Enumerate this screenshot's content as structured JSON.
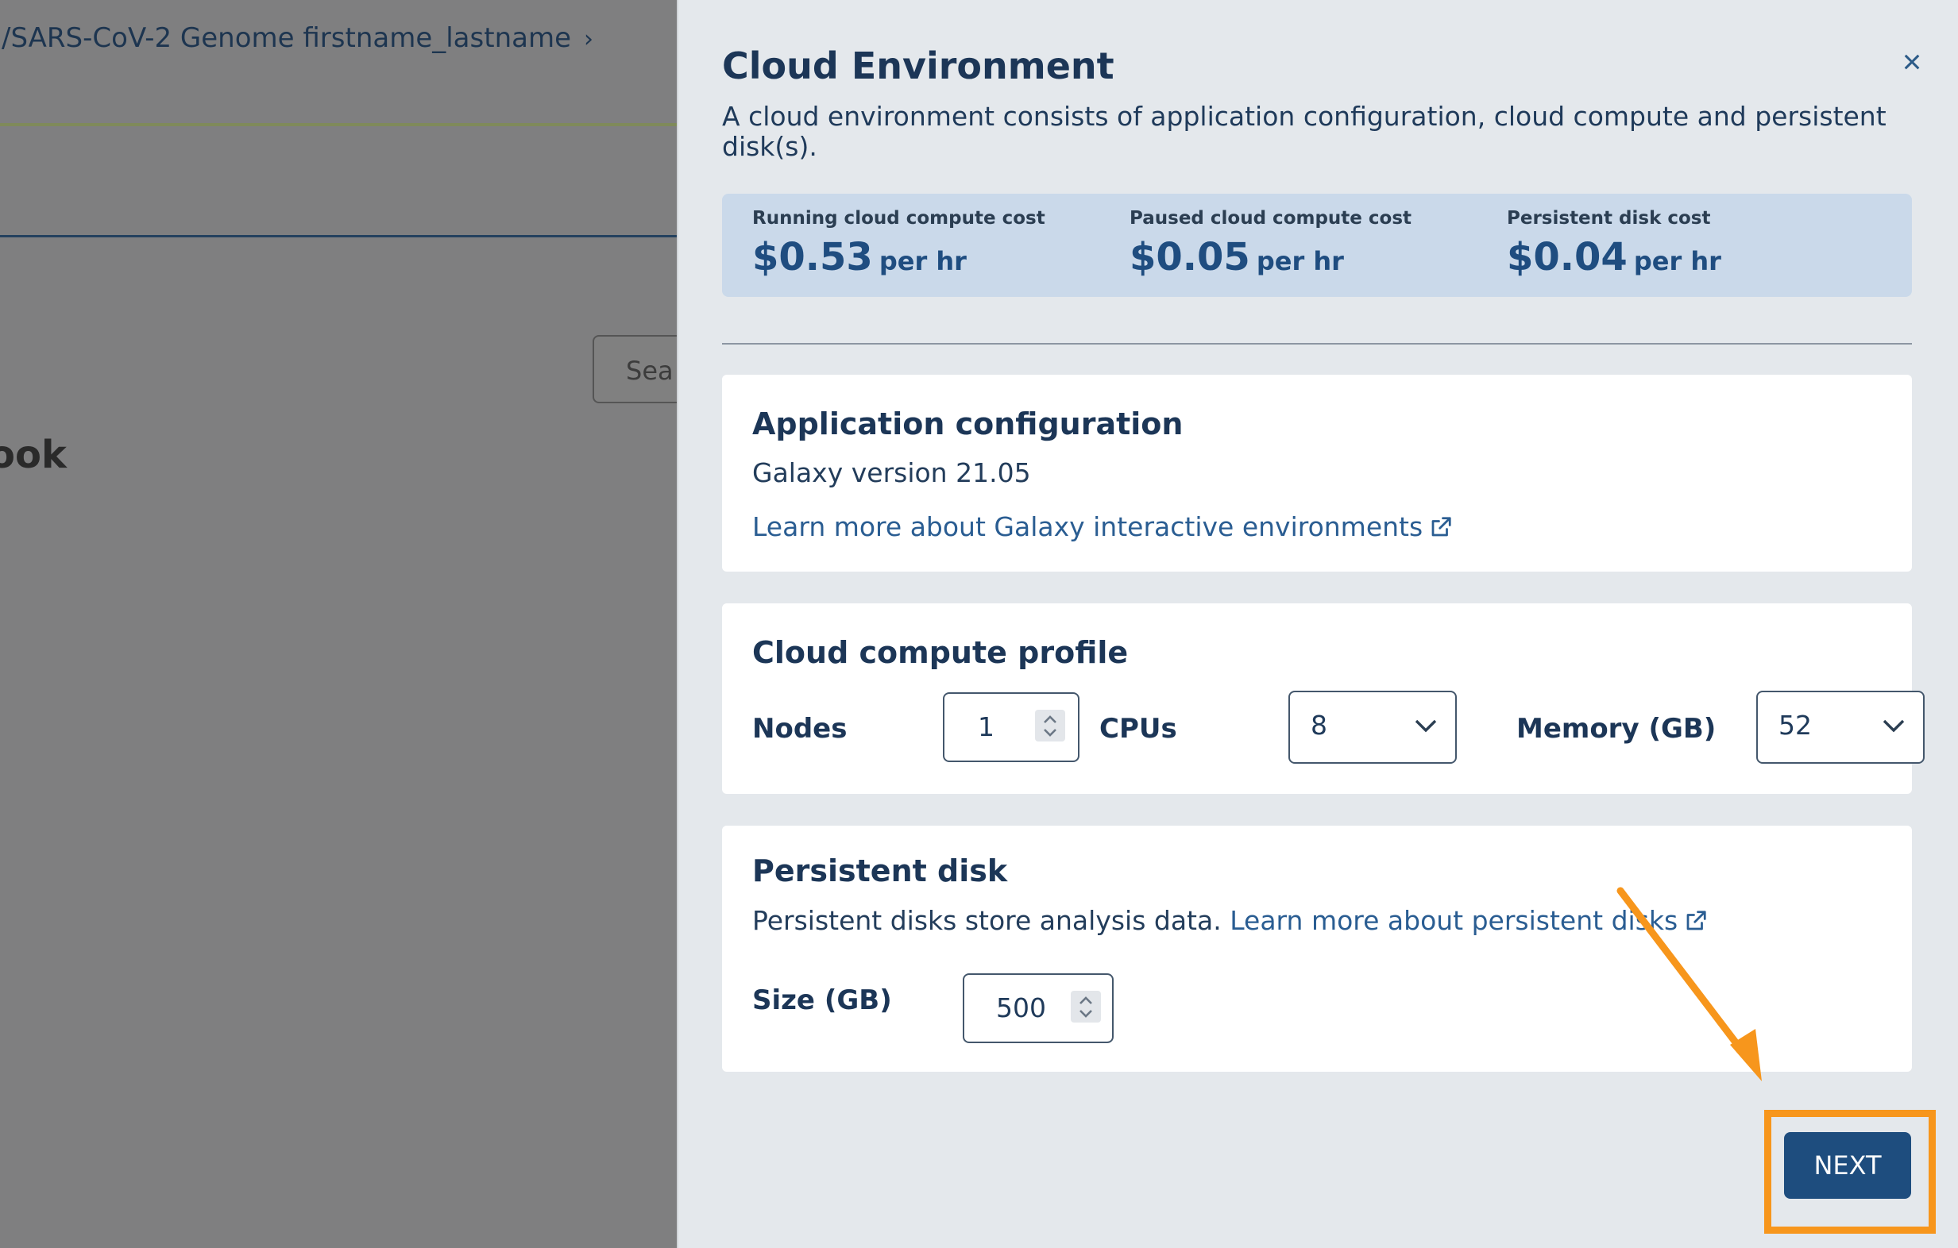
{
  "background": {
    "breadcrumb": "/SARS-CoV-2 Genome firstname_lastname",
    "breadcrumb_chevron": "›",
    "search_placeholder": "Sea",
    "heading_fragment": "ook"
  },
  "modal": {
    "title": "Cloud Environment",
    "close_icon": "×",
    "description": "A cloud environment consists of application configuration, cloud compute and persistent disk(s).",
    "costs": [
      {
        "label": "Running cloud compute cost",
        "value": "$0.53",
        "unit": "per hr"
      },
      {
        "label": "Paused cloud compute cost",
        "value": "$0.05",
        "unit": "per hr"
      },
      {
        "label": "Persistent disk cost",
        "value": "$0.04",
        "unit": "per hr"
      }
    ],
    "app_config": {
      "title": "Application configuration",
      "version": "Galaxy version 21.05",
      "link": "Learn more about Galaxy interactive environments"
    },
    "compute": {
      "title": "Cloud compute profile",
      "nodes_label": "Nodes",
      "nodes_value": "1",
      "cpus_label": "CPUs",
      "cpus_value": "8",
      "memory_label": "Memory (GB)",
      "memory_value": "52"
    },
    "disk": {
      "title": "Persistent disk",
      "description": "Persistent disks store analysis data.",
      "link": "Learn more about persistent disks",
      "size_label": "Size (GB)",
      "size_value": "500"
    },
    "next_label": "NEXT"
  },
  "annotation": {
    "color": "#f7961c",
    "icons": [
      "external-link-icon",
      "arrow-annotation-icon",
      "chevron-down-icon",
      "spinner-icon"
    ]
  }
}
